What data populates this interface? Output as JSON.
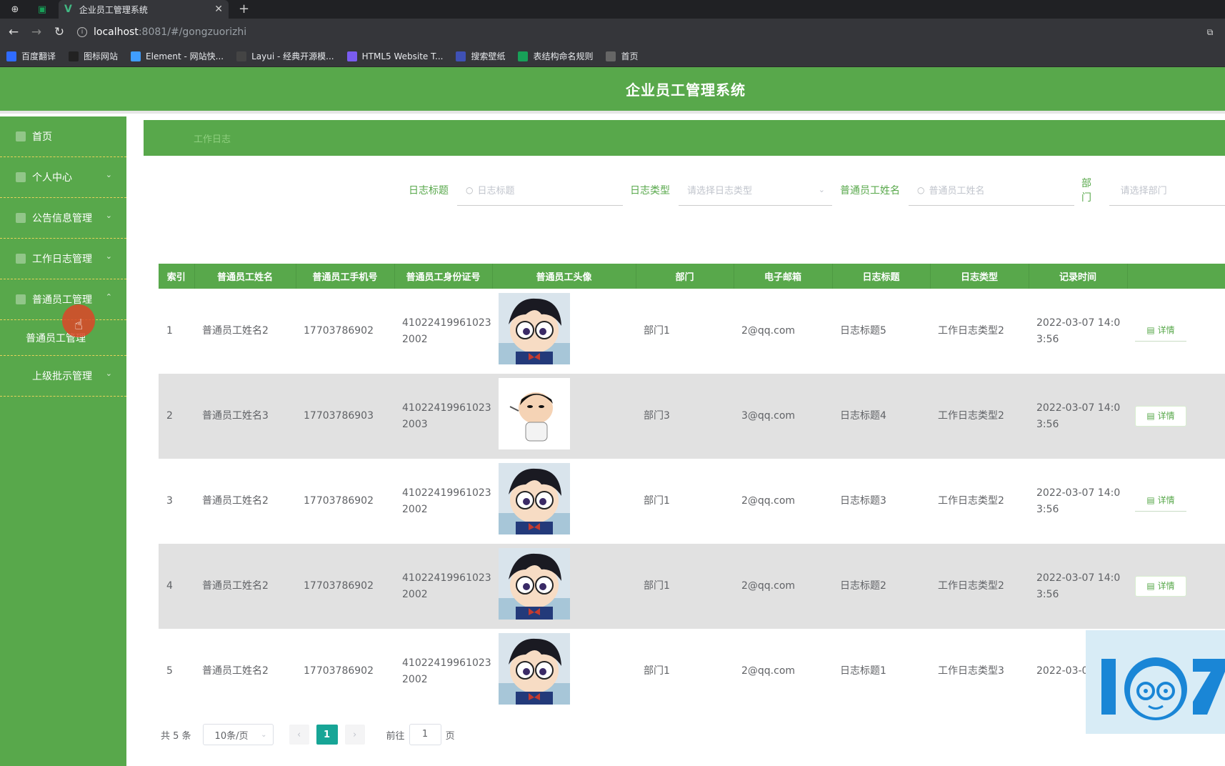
{
  "browser": {
    "tab_title": "企业员工管理系统",
    "url_host": "localhost",
    "url_path": ":8081/#/gongzuorizhi",
    "bookmarks": [
      {
        "label": "百度翻译",
        "icon": "baidu-translate-icon",
        "color": "#2f6bff"
      },
      {
        "label": "图标网站",
        "icon": "flag-icon",
        "color": "#222222"
      },
      {
        "label": "Element - 网站快...",
        "icon": "element-hexagon-icon",
        "color": "#409eff"
      },
      {
        "label": "Layui - 经典开源模...",
        "icon": "layui-icon",
        "color": "#444444"
      },
      {
        "label": "HTML5 Website T...",
        "icon": "html5-icon",
        "color": "#7a5cf0"
      },
      {
        "label": "搜索壁纸",
        "icon": "wallpaper-icon",
        "color": "#3f51b5"
      },
      {
        "label": "表结构命名规则",
        "icon": "sheet-icon",
        "color": "#18a058"
      },
      {
        "label": "首页",
        "icon": "globe-icon",
        "color": "#666666"
      }
    ]
  },
  "header": {
    "title": "企业员工管理系统"
  },
  "sidebar": {
    "items": [
      {
        "label": "首页",
        "chevron": ""
      },
      {
        "label": "个人中心",
        "chevron": "⌄"
      },
      {
        "label": "公告信息管理",
        "chevron": "⌄"
      },
      {
        "label": "工作日志管理",
        "chevron": "⌄"
      },
      {
        "label": "普通员工管理",
        "chevron": "⌃"
      }
    ],
    "submenu_label": "普通员工管理",
    "last_item": {
      "label": "上级批示管理",
      "chevron": "⌄"
    }
  },
  "main": {
    "breadcrumb": "工作日志"
  },
  "search": {
    "title_label": "日志标题",
    "title_placeholder": "日志标题",
    "type_label": "日志类型",
    "type_placeholder": "请选择日志类型",
    "name_label": "普通员工姓名",
    "name_placeholder": "普通员工姓名",
    "dept_label": "部门",
    "dept_placeholder": "请选择部门"
  },
  "table": {
    "headers": [
      "索引",
      "普通员工姓名",
      "普通员工手机号",
      "普通员工身份证号",
      "普通员工头像",
      "部门",
      "电子邮箱",
      "日志标题",
      "日志类型",
      "记录时间",
      ""
    ],
    "detail_label": "详情",
    "rows": [
      {
        "index": "1",
        "name": "普通员工姓名2",
        "phone": "17703786902",
        "idcard": "410224199610232002",
        "avatar": "conan",
        "dept": "部门1",
        "email": "2@qq.com",
        "title": "日志标题5",
        "type": "工作日志类型2",
        "time": "2022-03-07 14:03:56"
      },
      {
        "index": "2",
        "name": "普通员工姓名3",
        "phone": "17703786903",
        "idcard": "410224199610232003",
        "avatar": "crayon",
        "dept": "部门3",
        "email": "3@qq.com",
        "title": "日志标题4",
        "type": "工作日志类型2",
        "time": "2022-03-07 14:03:56"
      },
      {
        "index": "3",
        "name": "普通员工姓名2",
        "phone": "17703786902",
        "idcard": "410224199610232002",
        "avatar": "conan",
        "dept": "部门1",
        "email": "2@qq.com",
        "title": "日志标题3",
        "type": "工作日志类型2",
        "time": "2022-03-07 14:03:56"
      },
      {
        "index": "4",
        "name": "普通员工姓名2",
        "phone": "17703786902",
        "idcard": "410224199610232002",
        "avatar": "conan",
        "dept": "部门1",
        "email": "2@qq.com",
        "title": "日志标题2",
        "type": "工作日志类型2",
        "time": "2022-03-07 14:03:56"
      },
      {
        "index": "5",
        "name": "普通员工姓名2",
        "phone": "17703786902",
        "idcard": "410224199610232002",
        "avatar": "conan",
        "dept": "部门1",
        "email": "2@qq.com",
        "title": "日志标题1",
        "type": "工作日志类型3",
        "time": "2022-03-0"
      }
    ]
  },
  "pager": {
    "total": "共 5 条",
    "page_size": "10条/页",
    "current": "1",
    "goto_prefix": "前往",
    "goto_value": "1",
    "goto_suffix": "页"
  },
  "colors": {
    "primary": "#58a84b",
    "pager_active": "#17a596",
    "stripe": "#e1e1e1"
  }
}
